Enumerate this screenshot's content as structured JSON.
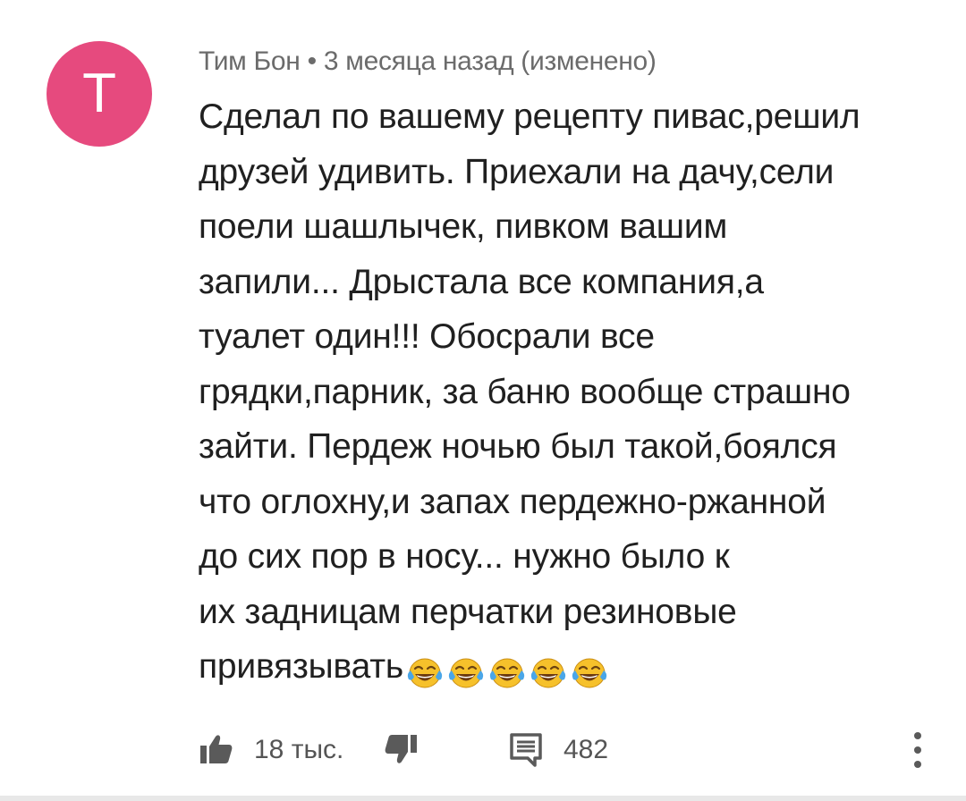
{
  "comment": {
    "avatar_letter": "Т",
    "avatar_color": "#e64a7e",
    "meta": "Тим Бон • 3 месяца назад (изменено)",
    "lines": [
      "Сделал по вашему рецепту пивас,решил",
      "друзей удивить. Приехали на дачу,сели",
      "поели шашлычек, пивком вашим",
      "запили... Дрыстала все компания,а",
      "туалет один!!! Обосрали все",
      "грядки,парник, за баню вообще страшно",
      "зайти. Пердеж ночью был такой,боялся",
      "что оглохну,и запах пердежно-ржанной",
      "до сих пор в носу...  нужно было  к",
      "их задницам перчатки резиновые",
      "привязывать"
    ],
    "emoji_icon": "tears-of-joy-emoji",
    "emoji_count": 5
  },
  "actions": {
    "like_icon": "thumbs-up-icon",
    "like_count": "18 тыс.",
    "dislike_icon": "thumbs-down-icon",
    "reply_icon": "reply-icon",
    "reply_count": "482",
    "more_icon": "more-vertical-icon"
  }
}
